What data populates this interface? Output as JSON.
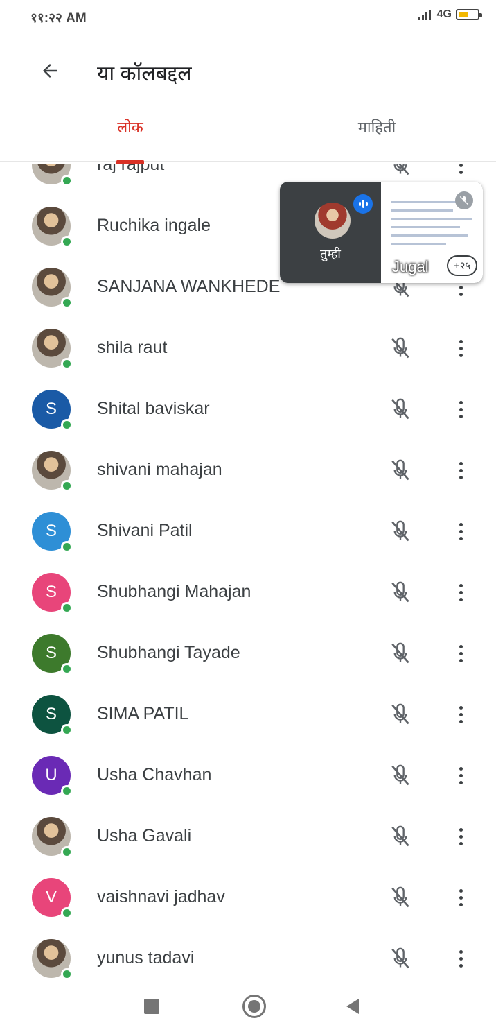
{
  "status_bar": {
    "time": "११:२२ AM",
    "network": "4G",
    "battery_level": 0.5
  },
  "header": {
    "title": "या कॉलबद्दल"
  },
  "tabs": [
    {
      "label": "लोक",
      "active": true
    },
    {
      "label": "माहिती",
      "active": false
    }
  ],
  "participants": [
    {
      "name": "raj rajput",
      "avatar_type": "photo",
      "initial": "",
      "color": "",
      "muted": true
    },
    {
      "name": "Ruchika ingale",
      "avatar_type": "photo",
      "initial": "",
      "color": "",
      "muted": true
    },
    {
      "name": "SANJANA WANKHEDE",
      "avatar_type": "photo",
      "initial": "",
      "color": "",
      "muted": true
    },
    {
      "name": "shila raut",
      "avatar_type": "photo",
      "initial": "",
      "color": "",
      "muted": true
    },
    {
      "name": "Shital baviskar",
      "avatar_type": "letter",
      "initial": "S",
      "color": "#1a5aa6",
      "muted": true
    },
    {
      "name": "shivani mahajan",
      "avatar_type": "photo",
      "initial": "",
      "color": "",
      "muted": true
    },
    {
      "name": "Shivani Patil",
      "avatar_type": "letter",
      "initial": "S",
      "color": "#2e8fd6",
      "muted": true
    },
    {
      "name": "Shubhangi Mahajan",
      "avatar_type": "letter",
      "initial": "S",
      "color": "#e8457a",
      "muted": true
    },
    {
      "name": "Shubhangi Tayade",
      "avatar_type": "letter",
      "initial": "S",
      "color": "#3d7a2c",
      "muted": true
    },
    {
      "name": "SIMA PATIL",
      "avatar_type": "letter",
      "initial": "S",
      "color": "#0d5340",
      "muted": true
    },
    {
      "name": "Usha Chavhan",
      "avatar_type": "letter",
      "initial": "U",
      "color": "#6a2ab5",
      "muted": true
    },
    {
      "name": "Usha Gavali",
      "avatar_type": "photo",
      "initial": "",
      "color": "",
      "muted": true
    },
    {
      "name": "vaishnavi jadhav",
      "avatar_type": "letter",
      "initial": "V",
      "color": "#e8457a",
      "muted": true
    },
    {
      "name": "yunus tadavi",
      "avatar_type": "photo",
      "initial": "",
      "color": "",
      "muted": true
    }
  ],
  "pip": {
    "self_label": "तुम्ही",
    "presenter_label": "Jugal",
    "more_count": "+२५"
  },
  "colors": {
    "accent": "#d93025",
    "presence": "#34a853",
    "speaking": "#1a73e8"
  }
}
